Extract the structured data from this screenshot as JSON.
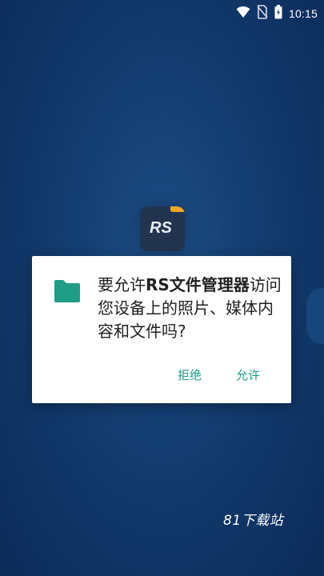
{
  "status_bar": {
    "time": "10:15",
    "icons": [
      "wifi-icon",
      "no-sim-icon",
      "battery-icon"
    ]
  },
  "background": {
    "app_icon_label": "RS"
  },
  "dialog": {
    "message_prefix": "要允许",
    "app_name": "RS文件管理器",
    "message_suffix": "访问您设备上的照片、媒体内容和文件吗?",
    "deny_label": "拒绝",
    "allow_label": "允许",
    "accent_color": "#1f9e86",
    "icon": "folder-icon"
  },
  "watermark": {
    "text": "81下载站"
  }
}
